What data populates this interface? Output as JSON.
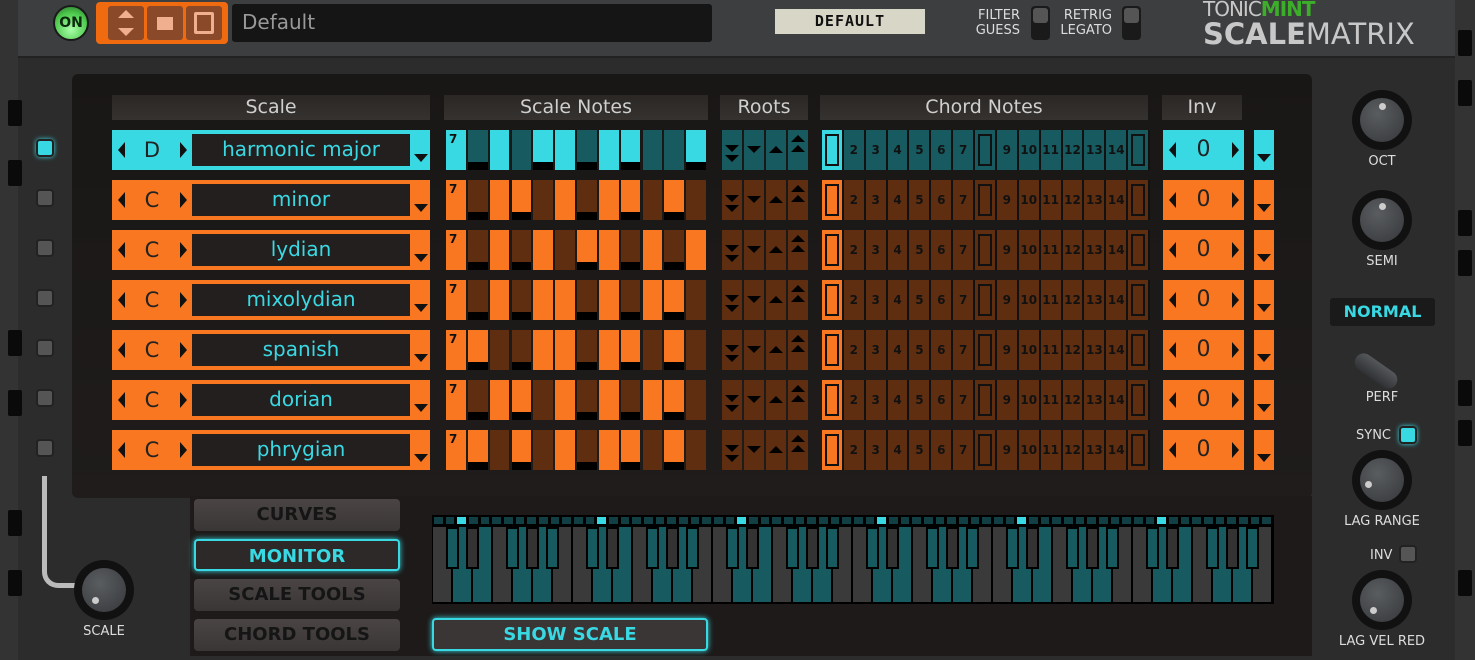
{
  "header": {
    "power_label": "ON",
    "preset_name": "Default",
    "patch_tag": "DEFAULT",
    "filter_guess_label": [
      "FILTER",
      "GUESS"
    ],
    "retrig_legato_label": [
      "RETRIG",
      "LEGATO"
    ],
    "brand_top": "TONIC",
    "brand_top_accent": "MINT",
    "brand_bottom": "SCALE",
    "brand_bottom_thin": "MATRIX"
  },
  "columns": {
    "scale": "Scale",
    "scale_notes": "Scale Notes",
    "roots": "Roots",
    "chord_notes": "Chord Notes",
    "inv": "Inv"
  },
  "colors": {
    "active": "#39d9e4",
    "active_dim": "#175a60",
    "inactive": "#f87720",
    "inactive_dim": "#5f2e10"
  },
  "scale_notes_count_label": "7",
  "chord_note_labels": [
    "",
    "2",
    "3",
    "4",
    "5",
    "6",
    "7",
    "",
    "9",
    "10",
    "11",
    "12",
    "13",
    "14",
    ""
  ],
  "rows": [
    {
      "active": true,
      "root": "D",
      "scale": "harmonic major",
      "notes": [
        1,
        0,
        1,
        0,
        1,
        1,
        0,
        1,
        1,
        0,
        0,
        1
      ],
      "black": [
        1,
        4,
        6,
        8,
        11
      ],
      "inv": "0"
    },
    {
      "active": false,
      "root": "C",
      "scale": "minor",
      "notes": [
        1,
        0,
        1,
        1,
        0,
        1,
        0,
        1,
        1,
        0,
        1,
        0
      ],
      "black": [
        1,
        3,
        6,
        8,
        10
      ],
      "inv": "0"
    },
    {
      "active": false,
      "root": "C",
      "scale": "lydian",
      "notes": [
        1,
        0,
        1,
        0,
        1,
        0,
        1,
        1,
        0,
        1,
        0,
        1
      ],
      "black": [
        1,
        3,
        6,
        8,
        10
      ],
      "inv": "0"
    },
    {
      "active": false,
      "root": "C",
      "scale": "mixolydian",
      "notes": [
        1,
        0,
        1,
        0,
        1,
        1,
        0,
        1,
        0,
        1,
        1,
        0
      ],
      "black": [
        1,
        3,
        6,
        8,
        10
      ],
      "inv": "0"
    },
    {
      "active": false,
      "root": "C",
      "scale": "spanish",
      "notes": [
        1,
        1,
        0,
        0,
        1,
        1,
        0,
        1,
        1,
        0,
        1,
        0
      ],
      "black": [
        1,
        3,
        6,
        8,
        10
      ],
      "inv": "0"
    },
    {
      "active": false,
      "root": "C",
      "scale": "dorian",
      "notes": [
        1,
        0,
        1,
        1,
        0,
        1,
        0,
        1,
        0,
        1,
        1,
        0
      ],
      "black": [
        1,
        3,
        6,
        8,
        10
      ],
      "inv": "0"
    },
    {
      "active": false,
      "root": "C",
      "scale": "phrygian",
      "notes": [
        1,
        1,
        0,
        1,
        0,
        1,
        0,
        1,
        1,
        0,
        1,
        0
      ],
      "black": [
        1,
        3,
        6,
        8,
        10
      ],
      "inv": "0"
    }
  ],
  "right_panel": {
    "oct_label": "OCT",
    "semi_label": "SEMI",
    "perf_mode": "NORMAL",
    "perf_label": "PERF",
    "sync_label": "SYNC",
    "sync_on": true,
    "lag_range_label": "LAG RANGE",
    "inv_label": "INV",
    "inv_on": false,
    "lag_vel_red_label": "LAG VEL RED"
  },
  "bottom": {
    "scale_knob_label": "SCALE",
    "nav": [
      "CURVES",
      "MONITOR",
      "SCALE TOOLS",
      "CHORD TOOLS"
    ],
    "nav_active": 1,
    "show_scale_label": "SHOW SCALE",
    "keyboard_octaves": 6,
    "keyboard_scale_pcs": [
      2,
      4,
      6,
      7,
      9,
      10,
      1
    ],
    "keyboard_root_pc": 2
  }
}
